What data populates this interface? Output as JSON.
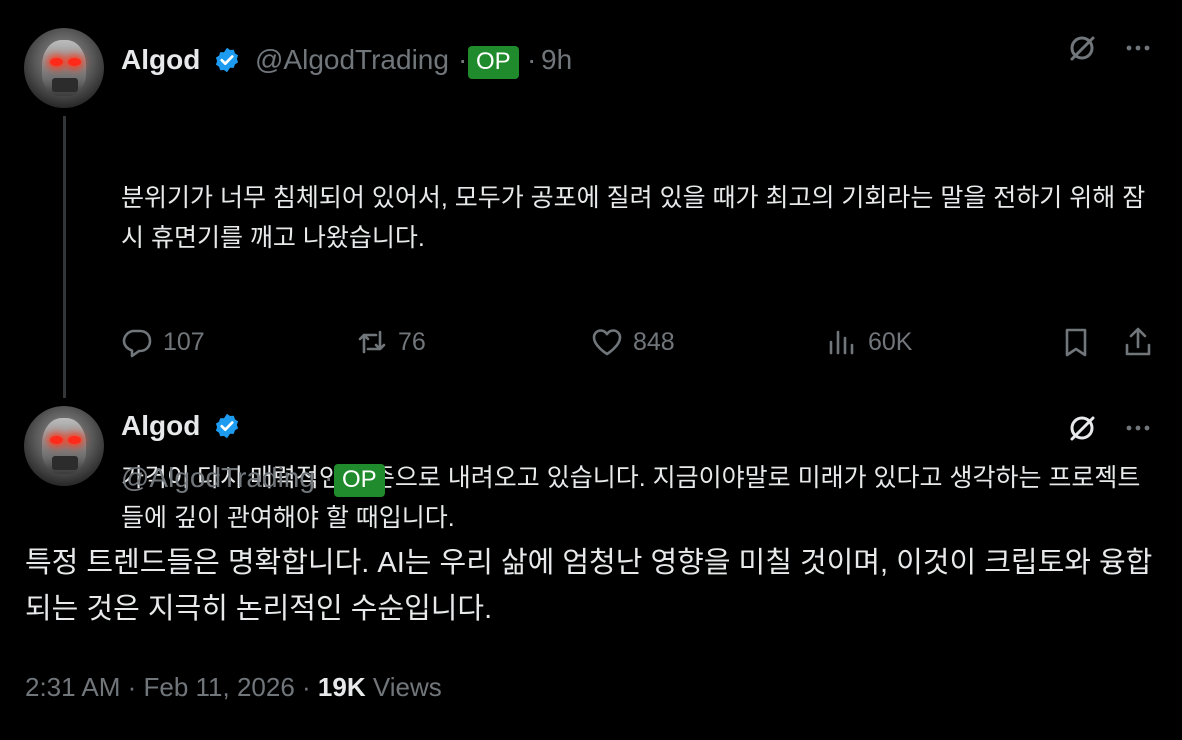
{
  "reply": {
    "author_name": "Algod",
    "handle": "@AlgodTrading",
    "op_badge": "OP",
    "separator": "·",
    "time_ago": "9h",
    "paragraph_1": "분위기가 너무 침체되어 있어서, 모두가 공포에 질려 있을 때가 최고의 기회라는 말을 전하기 위해 잠시 휴면기를 깨고 나왔습니다.",
    "paragraph_2": "가격이 다시 매력적인 수준으로 내려오고 있습니다. 지금이야말로 미래가 있다고 생각하는 프로젝트들에 깊이 관여해야 할 때입니다.",
    "stats": {
      "replies": "107",
      "reposts": "76",
      "likes": "848",
      "views": "60K"
    }
  },
  "main_post": {
    "author_name": "Algod",
    "handle": "@AlgodTrading",
    "op_badge": "OP",
    "separator": "·",
    "text": "특정 트렌드들은 명확합니다. AI는 우리 삶에 엄청난 영향을 미칠 것이며, 이것이 크립토와 융합되는 것은 지극히 논리적인 수순입니다.",
    "timestamp": "2:31 AM · Feb 11, 2026 · ",
    "views_count": "19K",
    "views_label": " Views"
  },
  "colors": {
    "background": "#000000",
    "text": "#e7e9ea",
    "muted": "#71767b",
    "verified": "#1d9bf0",
    "op_badge": "#1f8b2c"
  },
  "icons": [
    "verified-icon",
    "grok-icon",
    "more-icon",
    "reply-icon",
    "repost-icon",
    "like-icon",
    "views-icon",
    "bookmark-icon",
    "share-icon"
  ]
}
